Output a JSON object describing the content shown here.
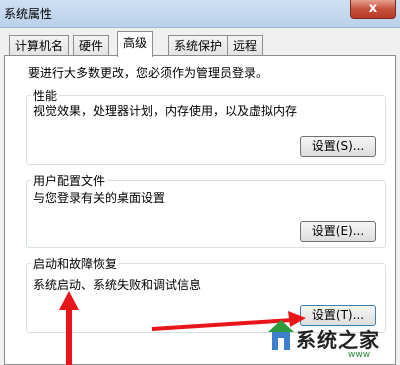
{
  "window": {
    "title": "系统属性",
    "close_label": "x"
  },
  "tabs": [
    {
      "label": "计算机名",
      "active": false
    },
    {
      "label": "硬件",
      "active": false
    },
    {
      "label": "高级",
      "active": true
    },
    {
      "label": "系统保护",
      "active": false
    },
    {
      "label": "远程",
      "active": false
    }
  ],
  "advanced": {
    "intro": "要进行大多数更改，您必须作为管理员登录。",
    "performance": {
      "label": "性能",
      "description": "视觉效果，处理器计划，内存使用，以及虚拟内存",
      "button": "设置(S)..."
    },
    "user_profiles": {
      "label": "用户配置文件",
      "description": "与您登录有关的桌面设置",
      "button": "设置(E)..."
    },
    "startup_recovery": {
      "label": "启动和故障恢复",
      "description": "系统启动、系统失败和调试信息",
      "button": "设置(T)..."
    }
  },
  "watermark": {
    "text": "系统之家",
    "sub": "www"
  },
  "colors": {
    "arrow": "#e8151b",
    "accent": "#3c7fb1"
  }
}
